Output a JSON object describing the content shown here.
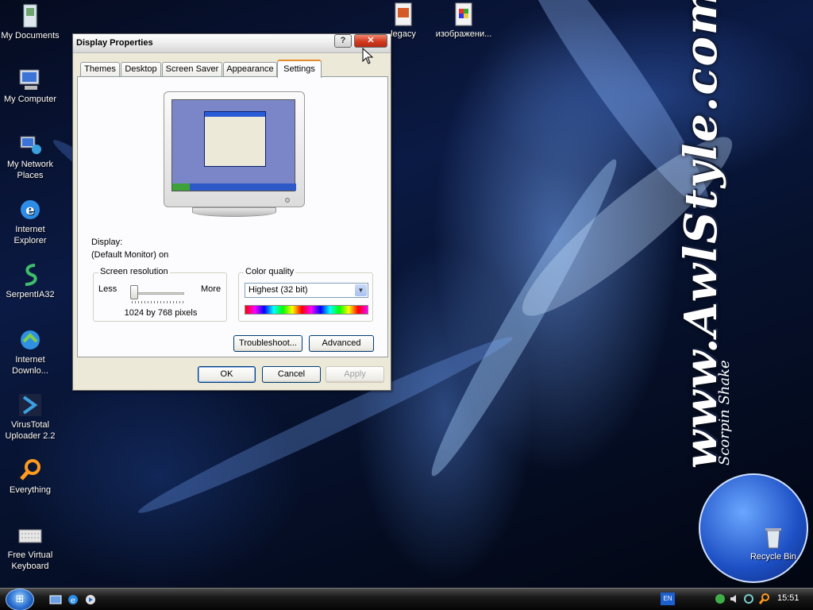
{
  "desktop": {
    "icons": [
      {
        "label": "My Documents",
        "icon": "my-documents-icon"
      },
      {
        "label": "My Computer",
        "icon": "my-computer-icon"
      },
      {
        "label": "My Network Places",
        "icon": "network-places-icon"
      },
      {
        "label": "Internet Explorer",
        "icon": "internet-explorer-icon"
      },
      {
        "label": "SerpentIA32",
        "icon": "serpent-icon"
      },
      {
        "label": "Internet Downlo...",
        "icon": "download-manager-icon"
      },
      {
        "label": "VirusTotal Uploader 2.2",
        "icon": "virustotal-icon"
      },
      {
        "label": "Everything",
        "icon": "magnifier-icon"
      },
      {
        "label": "Free Virtual Keyboard",
        "icon": "keyboard-icon"
      },
      {
        "label": "legacy",
        "icon": "file-icon"
      },
      {
        "label": "изображени...",
        "icon": "image-file-icon"
      },
      {
        "label": "Recycle Bin",
        "icon": "recycle-bin-icon"
      }
    ],
    "wallpaper_text": "www.AwlStyle.com",
    "wallpaper_signature": "Scorpin Shake"
  },
  "window": {
    "title": "Display Properties",
    "help_glyph": "?",
    "close_glyph": "✕",
    "tabs": [
      {
        "label": "Themes",
        "active": false
      },
      {
        "label": "Desktop",
        "active": false
      },
      {
        "label": "Screen Saver",
        "active": false
      },
      {
        "label": "Appearance",
        "active": false
      },
      {
        "label": "Settings",
        "active": true
      }
    ],
    "display_label": "Display:",
    "display_value": "(Default Monitor) on",
    "screen_resolution": {
      "title": "Screen resolution",
      "less": "Less",
      "more": "More",
      "value": "1024 by 768 pixels",
      "slider_level": 0
    },
    "color_quality": {
      "title": "Color quality",
      "selected": "Highest (32 bit)"
    },
    "buttons": {
      "troubleshoot": "Troubleshoot...",
      "advanced": "Advanced",
      "ok": "OK",
      "cancel": "Cancel",
      "apply": "Apply"
    }
  },
  "taskbar": {
    "language": "EN",
    "clock": "15:51"
  },
  "colors": {
    "accent_tab": "#e68b2c",
    "close_button": "#d23a1f",
    "taskbar": "#1a1a1a"
  }
}
